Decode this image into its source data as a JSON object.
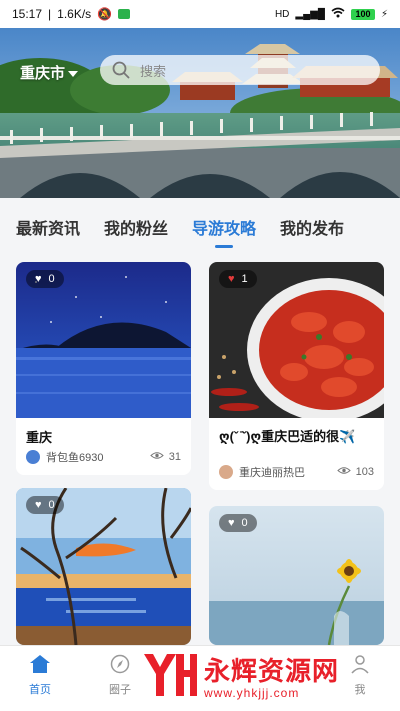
{
  "status_bar": {
    "time": "15:17",
    "speed": "1.6K/s",
    "network": "HD",
    "battery": "100"
  },
  "header": {
    "city": "重庆市",
    "search_placeholder": "搜索"
  },
  "banner": {
    "slide_count": 2,
    "active_slide": 2
  },
  "tabs": [
    {
      "label": "最新资讯",
      "active": false
    },
    {
      "label": "我的粉丝",
      "active": false
    },
    {
      "label": "导游攻略",
      "active": true
    },
    {
      "label": "我的发布",
      "active": false
    }
  ],
  "cards": [
    {
      "likes": "0",
      "title": "重庆",
      "author": "背包鱼6930",
      "views": "31"
    },
    {
      "likes": "1",
      "title": "ღ(ˇ ̄ˇ)ღ重庆巴适的很✈️",
      "author": "重庆迪丽热巴",
      "views": "103"
    },
    {
      "likes": "0"
    },
    {
      "likes": "0"
    }
  ],
  "bottom_nav": [
    {
      "label": "首页",
      "active": true
    },
    {
      "label": "圈子",
      "active": false
    },
    {
      "label": "我",
      "active": false
    }
  ],
  "watermark": {
    "name": "永辉资源网",
    "url": "www.yhkjjj.com"
  },
  "colors": {
    "accent": "#2b7bd6",
    "watermark": "#e8202a"
  }
}
